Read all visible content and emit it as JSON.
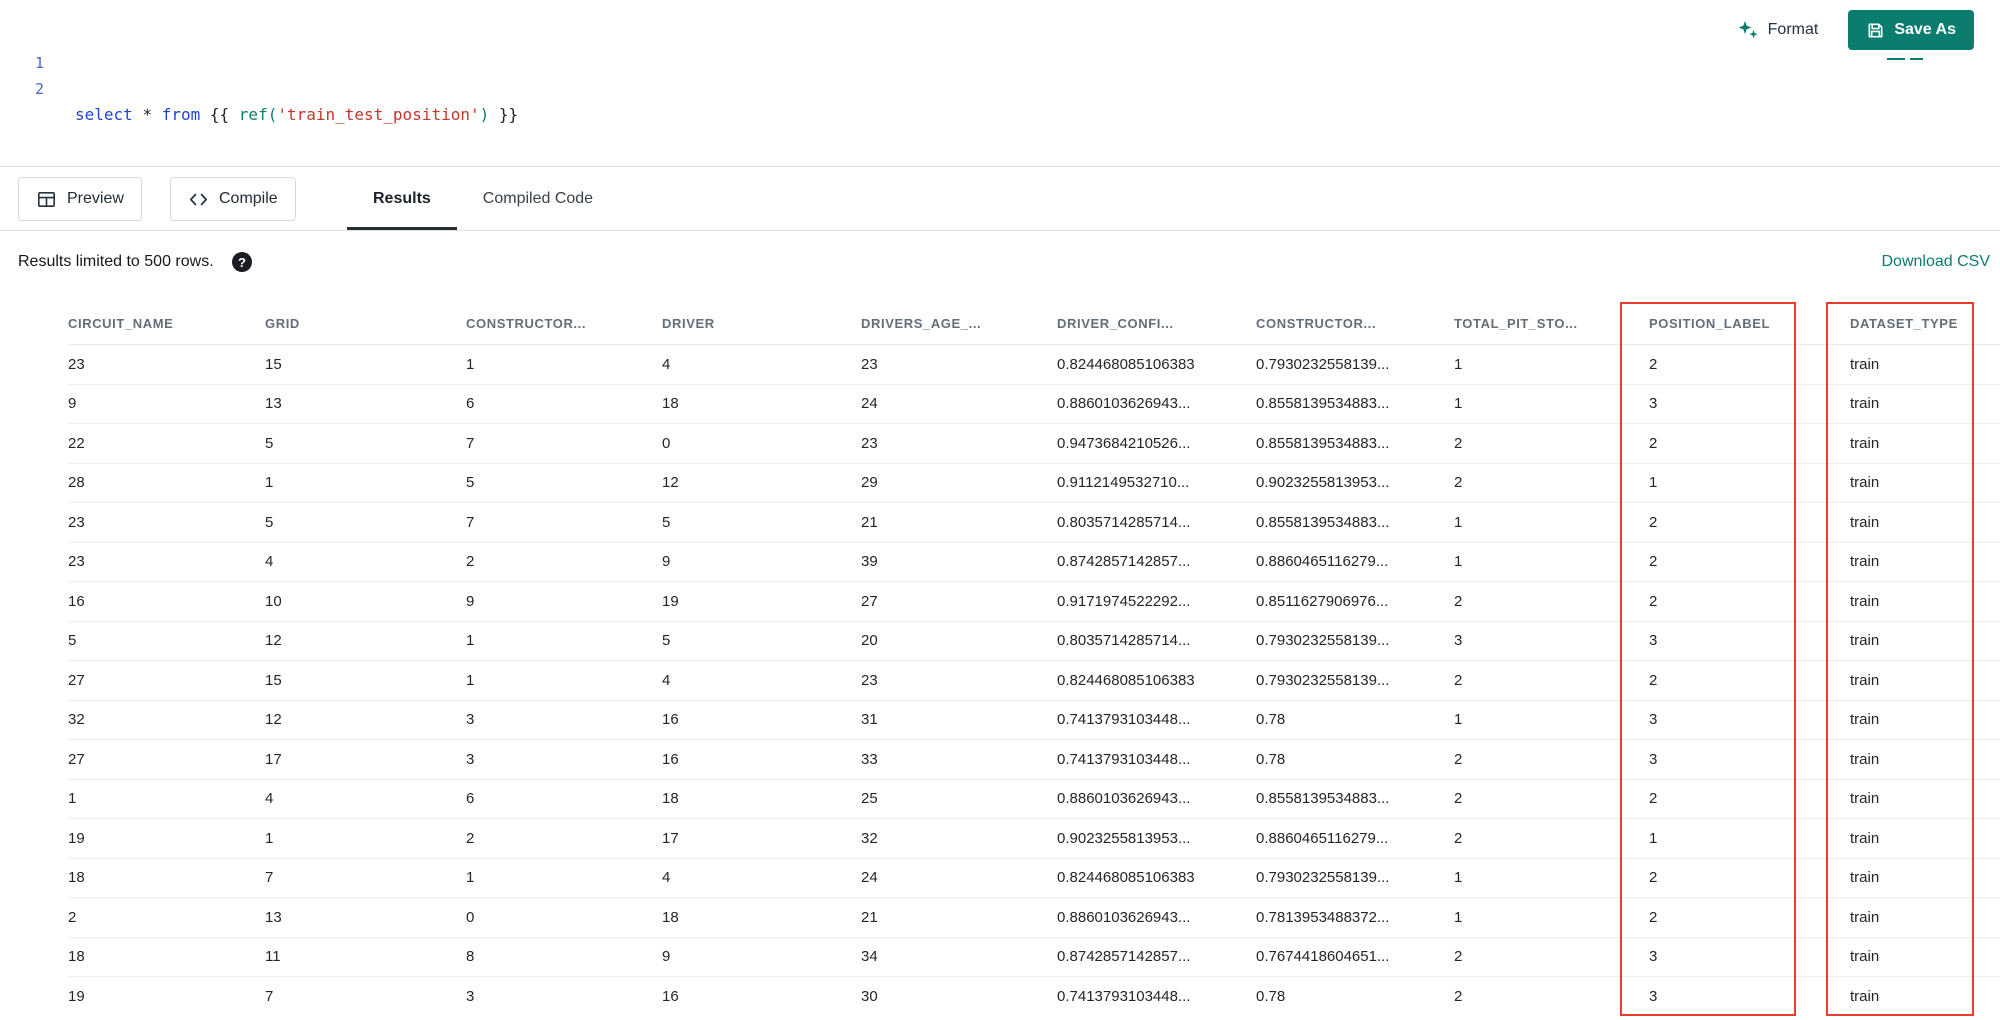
{
  "editor": {
    "line_numbers": [
      "1",
      "2"
    ],
    "code": {
      "keyword_select": "select",
      "operator_star": "*",
      "keyword_from": "from",
      "jinja_open": "{{",
      "function_ref": "ref(",
      "string_arg": "'train_test_position'",
      "paren_close": ")",
      "jinja_close": "}}"
    }
  },
  "toolbar": {
    "format_label": "Format",
    "save_as_label": "Save As"
  },
  "action_bar": {
    "preview_label": "Preview",
    "compile_label": "Compile",
    "tabs": [
      {
        "label": "Results",
        "active": true
      },
      {
        "label": "Compiled Code",
        "active": false
      }
    ]
  },
  "results_meta": {
    "limit_text": "Results limited to 500 rows.",
    "help_icon": "?",
    "download_csv_label": "Download CSV"
  },
  "table": {
    "columns": [
      "CIRCUIT_NAME",
      "GRID",
      "CONSTRUCTOR...",
      "DRIVER",
      "DRIVERS_AGE_...",
      "DRIVER_CONFI...",
      "CONSTRUCTOR...",
      "TOTAL_PIT_STO...",
      "POSITION_LABEL",
      "DATASET_TYPE"
    ],
    "highlighted_columns": [
      "POSITION_LABEL",
      "DATASET_TYPE"
    ],
    "rows": [
      [
        "23",
        "15",
        "1",
        "4",
        "23",
        "0.824468085106383",
        "0.7930232558139...",
        "1",
        "2",
        "train"
      ],
      [
        "9",
        "13",
        "6",
        "18",
        "24",
        "0.8860103626943...",
        "0.8558139534883...",
        "1",
        "3",
        "train"
      ],
      [
        "22",
        "5",
        "7",
        "0",
        "23",
        "0.9473684210526...",
        "0.8558139534883...",
        "2",
        "2",
        "train"
      ],
      [
        "28",
        "1",
        "5",
        "12",
        "29",
        "0.9112149532710...",
        "0.9023255813953...",
        "2",
        "1",
        "train"
      ],
      [
        "23",
        "5",
        "7",
        "5",
        "21",
        "0.8035714285714...",
        "0.8558139534883...",
        "1",
        "2",
        "train"
      ],
      [
        "23",
        "4",
        "2",
        "9",
        "39",
        "0.8742857142857...",
        "0.8860465116279...",
        "1",
        "2",
        "train"
      ],
      [
        "16",
        "10",
        "9",
        "19",
        "27",
        "0.9171974522292...",
        "0.8511627906976...",
        "2",
        "2",
        "train"
      ],
      [
        "5",
        "12",
        "1",
        "5",
        "20",
        "0.8035714285714...",
        "0.7930232558139...",
        "3",
        "3",
        "train"
      ],
      [
        "27",
        "15",
        "1",
        "4",
        "23",
        "0.824468085106383",
        "0.7930232558139...",
        "2",
        "2",
        "train"
      ],
      [
        "32",
        "12",
        "3",
        "16",
        "31",
        "0.7413793103448...",
        "0.78",
        "1",
        "3",
        "train"
      ],
      [
        "27",
        "17",
        "3",
        "16",
        "33",
        "0.7413793103448...",
        "0.78",
        "2",
        "3",
        "train"
      ],
      [
        "1",
        "4",
        "6",
        "18",
        "25",
        "0.8860103626943...",
        "0.8558139534883...",
        "2",
        "2",
        "train"
      ],
      [
        "19",
        "1",
        "2",
        "17",
        "32",
        "0.9023255813953...",
        "0.8860465116279...",
        "2",
        "1",
        "train"
      ],
      [
        "18",
        "7",
        "1",
        "4",
        "24",
        "0.824468085106383",
        "0.7930232558139...",
        "1",
        "2",
        "train"
      ],
      [
        "2",
        "13",
        "0",
        "18",
        "21",
        "0.8860103626943...",
        "0.7813953488372...",
        "1",
        "2",
        "train"
      ],
      [
        "18",
        "11",
        "8",
        "9",
        "34",
        "0.8742857142857...",
        "0.7674418604651...",
        "2",
        "3",
        "train"
      ],
      [
        "19",
        "7",
        "3",
        "16",
        "30",
        "0.7413793103448...",
        "0.78",
        "2",
        "3",
        "train"
      ]
    ]
  },
  "colors": {
    "accent_teal": "#0b7d6e",
    "button_teal": "#0b7d6e",
    "function_teal": "#0d8070",
    "keyword_blue": "#1f45cc",
    "string_red": "#c4372d",
    "highlight_red": "#ee3b32"
  }
}
